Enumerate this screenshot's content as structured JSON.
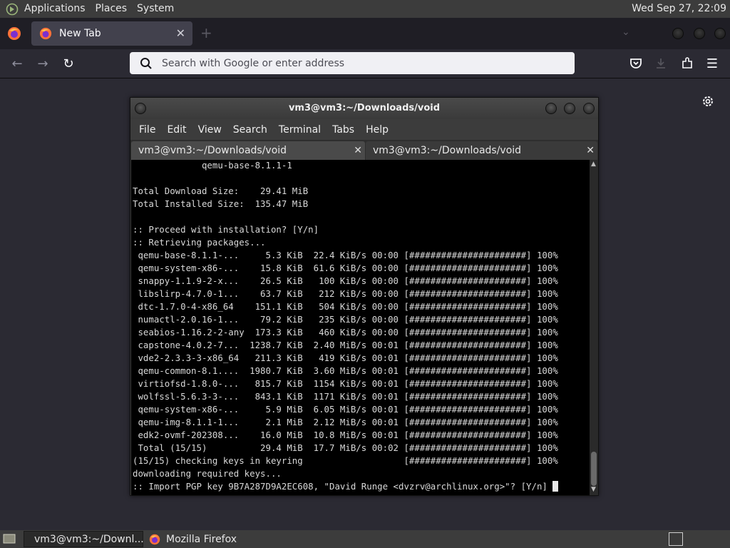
{
  "top_panel": {
    "menus": [
      "Applications",
      "Places",
      "System"
    ],
    "clock": "Wed Sep 27, 22:09"
  },
  "firefox": {
    "tab_title": "New Tab",
    "tab_close": "✕",
    "new_tab": "+",
    "list_tabs": "⌄",
    "url_placeholder": "Search with Google or enter address",
    "back": "←",
    "forward": "→",
    "reload": "↻",
    "menu": "☰"
  },
  "terminal": {
    "title": "vm3@vm3:~/Downloads/void",
    "menus": [
      "File",
      "Edit",
      "View",
      "Search",
      "Terminal",
      "Tabs",
      "Help"
    ],
    "tabs": [
      {
        "label": "vm3@vm3:~/Downloads/void",
        "close": "✕"
      },
      {
        "label": "vm3@vm3:~/Downloads/void",
        "close": "✕"
      }
    ],
    "lines": [
      "             qemu-base-8.1.1-1",
      "",
      "Total Download Size:    29.41 MiB",
      "Total Installed Size:  135.47 MiB",
      "",
      ":: Proceed with installation? [Y/n]",
      ":: Retrieving packages...",
      " qemu-base-8.1.1-...     5.3 KiB  22.4 KiB/s 00:00 [######################] 100%",
      " qemu-system-x86-...    15.8 KiB  61.6 KiB/s 00:00 [######################] 100%",
      " snappy-1.1.9-2-x...    26.5 KiB   100 KiB/s 00:00 [######################] 100%",
      " libslirp-4.7.0-1...    63.7 KiB   212 KiB/s 00:00 [######################] 100%",
      " dtc-1.7.0-4-x86_64    151.1 KiB   504 KiB/s 00:00 [######################] 100%",
      " numactl-2.0.16-1...    79.2 KiB   235 KiB/s 00:00 [######################] 100%",
      " seabios-1.16.2-2-any  173.3 KiB   460 KiB/s 00:00 [######################] 100%",
      " capstone-4.0.2-7...  1238.7 KiB  2.40 MiB/s 00:01 [######################] 100%",
      " vde2-2.3.3-3-x86_64   211.3 KiB   419 KiB/s 00:01 [######################] 100%",
      " qemu-common-8.1....  1980.7 KiB  3.60 MiB/s 00:01 [######################] 100%",
      " virtiofsd-1.8.0-...   815.7 KiB  1154 KiB/s 00:01 [######################] 100%",
      " wolfssl-5.6.3-3-...   843.1 KiB  1171 KiB/s 00:01 [######################] 100%",
      " qemu-system-x86-...     5.9 MiB  6.05 MiB/s 00:01 [######################] 100%",
      " qemu-img-8.1.1-1...     2.1 MiB  2.12 MiB/s 00:01 [######################] 100%",
      " edk2-ovmf-202308...    16.0 MiB  10.8 MiB/s 00:01 [######################] 100%",
      " Total (15/15)          29.4 MiB  17.7 MiB/s 00:02 [######################] 100%",
      "(15/15) checking keys in keyring                   [######################] 100%",
      "downloading required keys...",
      ":: Import PGP key 9B7A287D9A2EC608, \"David Runge <dvzrv@archlinux.org>\"? [Y/n] "
    ],
    "scroll_up": "▲",
    "scroll_down": "▼"
  },
  "taskbar": {
    "tasks": [
      "vm3@vm3:~/Downl...",
      "Mozilla Firefox"
    ]
  }
}
